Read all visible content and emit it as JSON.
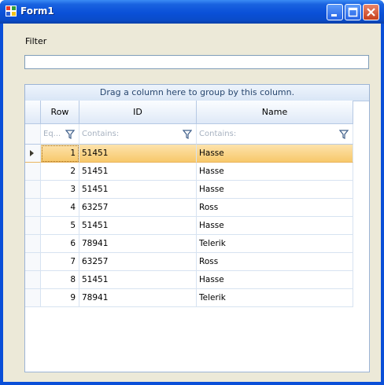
{
  "window": {
    "title": "Form1"
  },
  "filter": {
    "label": "Filter",
    "value": "",
    "placeholder": ""
  },
  "grid": {
    "group_panel_text": "Drag a column here to group by this column.",
    "columns": [
      "Row",
      "ID",
      "Name"
    ],
    "filters": [
      "Eq...",
      "Contains:",
      "Contains:"
    ],
    "rows": [
      {
        "row": "1",
        "id": "51451",
        "name": "Hasse",
        "current": true
      },
      {
        "row": "2",
        "id": "51451",
        "name": "Hasse"
      },
      {
        "row": "3",
        "id": "51451",
        "name": "Hasse"
      },
      {
        "row": "4",
        "id": "63257",
        "name": "Ross"
      },
      {
        "row": "5",
        "id": "51451",
        "name": "Hasse"
      },
      {
        "row": "6",
        "id": "78941",
        "name": "Telerik"
      },
      {
        "row": "7",
        "id": "63257",
        "name": "Ross"
      },
      {
        "row": "8",
        "id": "51451",
        "name": "Hasse"
      },
      {
        "row": "9",
        "id": "78941",
        "name": "Telerik"
      }
    ]
  }
}
